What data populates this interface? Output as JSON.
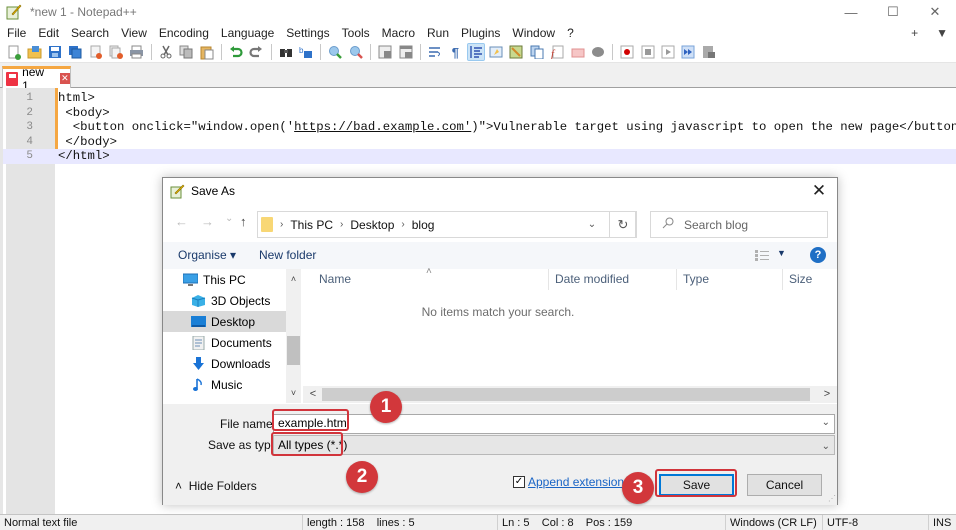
{
  "window": {
    "title": "*new 1 - Notepad++",
    "controls": {
      "minimize": "—",
      "maximize": "☐",
      "close": "✕"
    }
  },
  "menu": {
    "items": [
      "File",
      "Edit",
      "Search",
      "View",
      "Encoding",
      "Language",
      "Settings",
      "Tools",
      "Macro",
      "Run",
      "Plugins",
      "Window",
      "?"
    ],
    "right": {
      "plus": "+",
      "dropdown": "▼"
    }
  },
  "toolbar": {
    "groups": [
      [
        "new-file",
        "open-file",
        "save",
        "save-all",
        "close",
        "close-all",
        "print"
      ],
      [
        "cut",
        "copy",
        "paste"
      ],
      [
        "undo",
        "redo"
      ],
      [
        "find",
        "replace"
      ],
      [
        "zoom-in",
        "zoom-out"
      ],
      [
        "sync-vertical",
        "sync-horizontal"
      ],
      [
        "word-wrap",
        "show-all-chars",
        "indent-guide",
        "define-language",
        "document-map",
        "document-list",
        "function-list",
        "folder-as-workspace",
        "monitoring"
      ],
      [
        "record-macro",
        "stop-recording",
        "play-macro",
        "run-macro-multiple",
        "save-macro"
      ]
    ]
  },
  "tabs": [
    {
      "label": "new 1",
      "state": "unsaved",
      "close": "✕"
    }
  ],
  "editor": {
    "lines": [
      {
        "n": "1",
        "pre": "html>",
        "link": "",
        "post": ""
      },
      {
        "n": "2",
        "pre": " <body>",
        "link": "",
        "post": ""
      },
      {
        "n": "3",
        "pre": "  <button onclick=\"window.open('",
        "link": "https://bad.example.com'",
        "post": ")\">Vulnerable target using javascript to open the new page</button>"
      },
      {
        "n": "4",
        "pre": " </body>",
        "link": "",
        "post": ""
      },
      {
        "n": "5",
        "pre": "</html>",
        "link": "",
        "post": ""
      }
    ],
    "current_line": 5
  },
  "status": {
    "type": "Normal text file",
    "length": "length : 158",
    "lines": "lines : 5",
    "ln": "Ln : 5",
    "col": "Col : 8",
    "pos": "Pos : 159",
    "eol": "Windows (CR LF)",
    "encoding": "UTF-8",
    "mode": "INS"
  },
  "dialog": {
    "title": "Save As",
    "close": "✕",
    "nav": {
      "back": "←",
      "forward": "→",
      "recent": "⌄",
      "up": "↑"
    },
    "breadcrumb": [
      "This PC",
      "Desktop",
      "blog"
    ],
    "breadcrumb_sep": "›",
    "address_dropdown": "⌄",
    "refresh": "↻",
    "search_placeholder": "Search blog",
    "search_icon": "⚲",
    "commands": {
      "organise": "Organise ▾",
      "new_folder": "New folder",
      "view_dropdown": "▼",
      "help": "?"
    },
    "nav_pane": {
      "items": [
        {
          "label": "This PC",
          "icon": "pc",
          "selected": false,
          "indent": 0
        },
        {
          "label": "3D Objects",
          "icon": "3d-objects",
          "selected": false,
          "indent": 1
        },
        {
          "label": "Desktop",
          "icon": "desktop",
          "selected": true,
          "indent": 1
        },
        {
          "label": "Documents",
          "icon": "documents",
          "selected": false,
          "indent": 1
        },
        {
          "label": "Downloads",
          "icon": "downloads",
          "selected": false,
          "indent": 1
        },
        {
          "label": "Music",
          "icon": "music",
          "selected": false,
          "indent": 1
        }
      ],
      "scroll_up": "˄",
      "scroll_down": "˅"
    },
    "columns": [
      "Name",
      "Date modified",
      "Type",
      "Size"
    ],
    "sort_indicator": "˄",
    "empty_message": "No items match your search.",
    "hscroll": {
      "left": "<",
      "right": ">"
    },
    "file_name_label": "File name:",
    "file_name_value": "example.html",
    "save_as_type_label": "Save as type:",
    "save_as_type_value": "All types (*.*)",
    "dropdown_arrow": "⌄",
    "hide_folders": "Hide Folders",
    "hide_folders_icon": "˄",
    "append_extension": {
      "label": "Append extension",
      "checked": true,
      "check": "✓"
    },
    "save_label": "Save",
    "cancel_label": "Cancel"
  },
  "annotations": {
    "step1": "1",
    "step2": "2",
    "step3": "3",
    "color": "#d2373b"
  }
}
